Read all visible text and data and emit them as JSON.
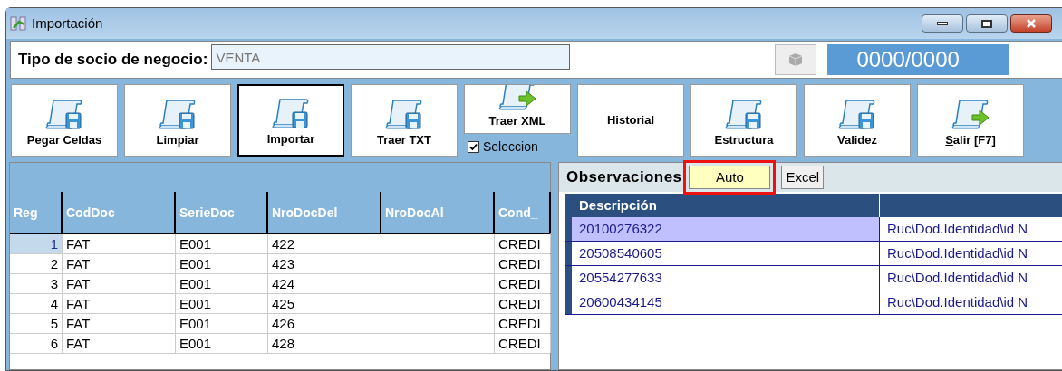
{
  "window": {
    "title": "Importación"
  },
  "partner": {
    "label": "Tipo de socio de negocio:",
    "value": "VENTA",
    "counter": "0000/0000"
  },
  "toolbar": [
    {
      "kind": "icon",
      "label": "Pegar Celdas",
      "pressed": false
    },
    {
      "kind": "icon",
      "label": "Limpiar",
      "pressed": false
    },
    {
      "kind": "icon",
      "label": "Importar",
      "pressed": true
    },
    {
      "kind": "icon",
      "label": "Traer TXT",
      "pressed": false
    },
    {
      "kind": "arrow-top",
      "label": "Traer XML",
      "pressed": false,
      "checkbox": {
        "label": "Seleccion",
        "checked": true
      }
    },
    {
      "kind": "text",
      "label": "Historial",
      "pressed": false
    },
    {
      "kind": "icon",
      "label": "Estructura",
      "pressed": false
    },
    {
      "kind": "icon",
      "label": "Validez",
      "pressed": false
    },
    {
      "kind": "arrow",
      "label": "Salir [F7]",
      "pressed": false,
      "underline_first": true
    }
  ],
  "grid": {
    "columns": [
      "Reg",
      "CodDoc",
      "SerieDoc",
      "NroDocDel",
      "NroDocAl",
      "Cond_"
    ],
    "rows": [
      {
        "selected": true,
        "cells": [
          "1",
          "FAT",
          "E001",
          "422",
          "",
          "CREDI"
        ]
      },
      {
        "selected": false,
        "cells": [
          "2",
          "FAT",
          "E001",
          "423",
          "",
          "CREDI"
        ]
      },
      {
        "selected": false,
        "cells": [
          "3",
          "FAT",
          "E001",
          "424",
          "",
          "CREDI"
        ]
      },
      {
        "selected": false,
        "cells": [
          "4",
          "FAT",
          "E001",
          "425",
          "",
          "CREDI"
        ]
      },
      {
        "selected": false,
        "cells": [
          "5",
          "FAT",
          "E001",
          "426",
          "",
          "CREDI"
        ]
      },
      {
        "selected": false,
        "cells": [
          "6",
          "FAT",
          "E001",
          "428",
          "",
          "CREDI"
        ]
      }
    ]
  },
  "observations": {
    "title": "Observaciones",
    "buttons": [
      {
        "label": "Auto",
        "highlighted": true
      },
      {
        "label": "Excel",
        "highlighted": false
      }
    ],
    "columns": [
      "Descripción"
    ],
    "rows": [
      {
        "selected": true,
        "cells": [
          "20100276322",
          "Ruc\\Dod.Identidad\\id N"
        ]
      },
      {
        "selected": false,
        "cells": [
          "20508540605",
          "Ruc\\Dod.Identidad\\id N"
        ]
      },
      {
        "selected": false,
        "cells": [
          "20554277633",
          "Ruc\\Dod.Identidad\\id N"
        ]
      },
      {
        "selected": false,
        "cells": [
          "20600434145",
          "Ruc\\Dod.Identidad\\id N"
        ]
      }
    ]
  }
}
